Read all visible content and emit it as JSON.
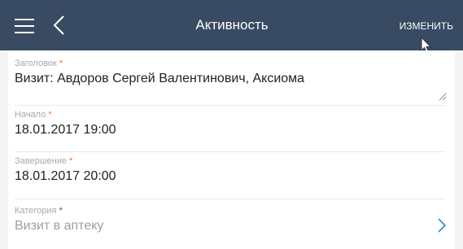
{
  "header": {
    "title": "Активность",
    "edit_label": "ИЗМЕНИТЬ"
  },
  "fields": [
    {
      "label": "Заголовок",
      "required_mark": "*",
      "value": "Визит: Авдоров Сергей Валентинович, Аксиома"
    },
    {
      "label": "Начало",
      "required_mark": "*",
      "value": "18.01.2017 19:00"
    },
    {
      "label": "Завершение",
      "required_mark": "*",
      "value": "18.01.2017 20:00"
    },
    {
      "label": "Категория",
      "required_mark": "*",
      "value": "Визит в аптеку"
    }
  ],
  "colors": {
    "header_bg": "#394a63",
    "required": "#f27126",
    "chevron": "#2a8fd6"
  }
}
